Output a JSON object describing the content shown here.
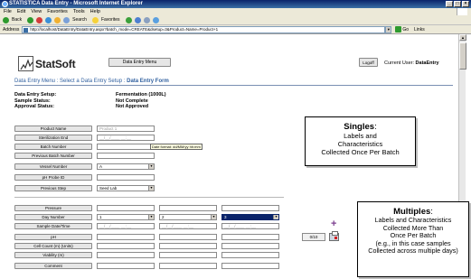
{
  "browser": {
    "window_title": "STATISTICA Data Entry - Microsoft Internet Explorer",
    "menu": [
      "File",
      "Edit",
      "View",
      "Favorites",
      "Tools",
      "Help"
    ],
    "toolbar": {
      "back": "Back",
      "search": "Search",
      "favorites": "Favorites"
    },
    "address_label": "Address",
    "address_url": "http://localhost/DataEntry/DataEntry.aspx?batch_mode=CREATE&dsetup=3&Product=Name=Product+1",
    "go_label": "Go",
    "links_label": "Links"
  },
  "app": {
    "logo_text": "StatSoft",
    "menu_button": "Data Entry Menu",
    "logoff_button": "Logoff",
    "current_user_label": "Current User:",
    "current_user": "DataEntry",
    "breadcrumb": {
      "item1": "Data Entry Menu",
      "sep1": " : ",
      "item2": "Select a Data Entry Setup",
      "sep2": " : ",
      "current": "Data Entry Form"
    },
    "info": {
      "labels": [
        "Data Entry Setup:",
        "Sample Status:",
        "Approval Status:"
      ],
      "values": [
        "Fermentation (1000L)",
        "Not Complete",
        "Not Approved"
      ]
    }
  },
  "singles_form": {
    "rows": [
      {
        "label": "Product Name",
        "value": "Product 1"
      },
      {
        "label": "Sterilization End",
        "value": "__/__/____ __:__"
      },
      {
        "label": "Batch Number",
        "value": ""
      },
      {
        "label": "Previous Batch Number",
        "value": ""
      },
      {
        "label": "Vessel Number",
        "value": "A"
      },
      {
        "label": "pH Probe ID",
        "value": ""
      },
      {
        "label": "Previous Step",
        "value": "Seed Lab"
      }
    ],
    "date_tooltip": "Date format: dd/MM/yy hh:mm"
  },
  "multiples_form": {
    "rows": [
      {
        "label": "Pressure"
      },
      {
        "label": "Day Number",
        "values": [
          "1",
          "2",
          "3"
        ]
      },
      {
        "label": "Sample Date/Time",
        "values": [
          "__/__/____ __:__",
          "__/__/____ __:__",
          "__/__/____ __:__"
        ]
      },
      {
        "label": "pH"
      },
      {
        "label": "Cell Count (m) (Units)"
      },
      {
        "label": "Viability (m)"
      },
      {
        "label": "Comment"
      }
    ],
    "counter": "0/10"
  },
  "annotations": {
    "singles": {
      "title": "Singles",
      "colon": ":",
      "lines": [
        "Labels and",
        "Characteristics",
        "Collected Once Per Batch"
      ]
    },
    "multiples": {
      "title": "Multiples",
      "colon": ":",
      "lines": [
        "Labels and Characteristics",
        "Collected More Than",
        "Once Per Batch",
        "(e.g., in this case samples",
        "Collected across multiple days)"
      ]
    }
  },
  "colors": {
    "title_bar": "#0a246a",
    "link_blue": "#2f5f9f",
    "plus_icon": "#7b3e8e",
    "selected_blue": "#0a246a"
  }
}
